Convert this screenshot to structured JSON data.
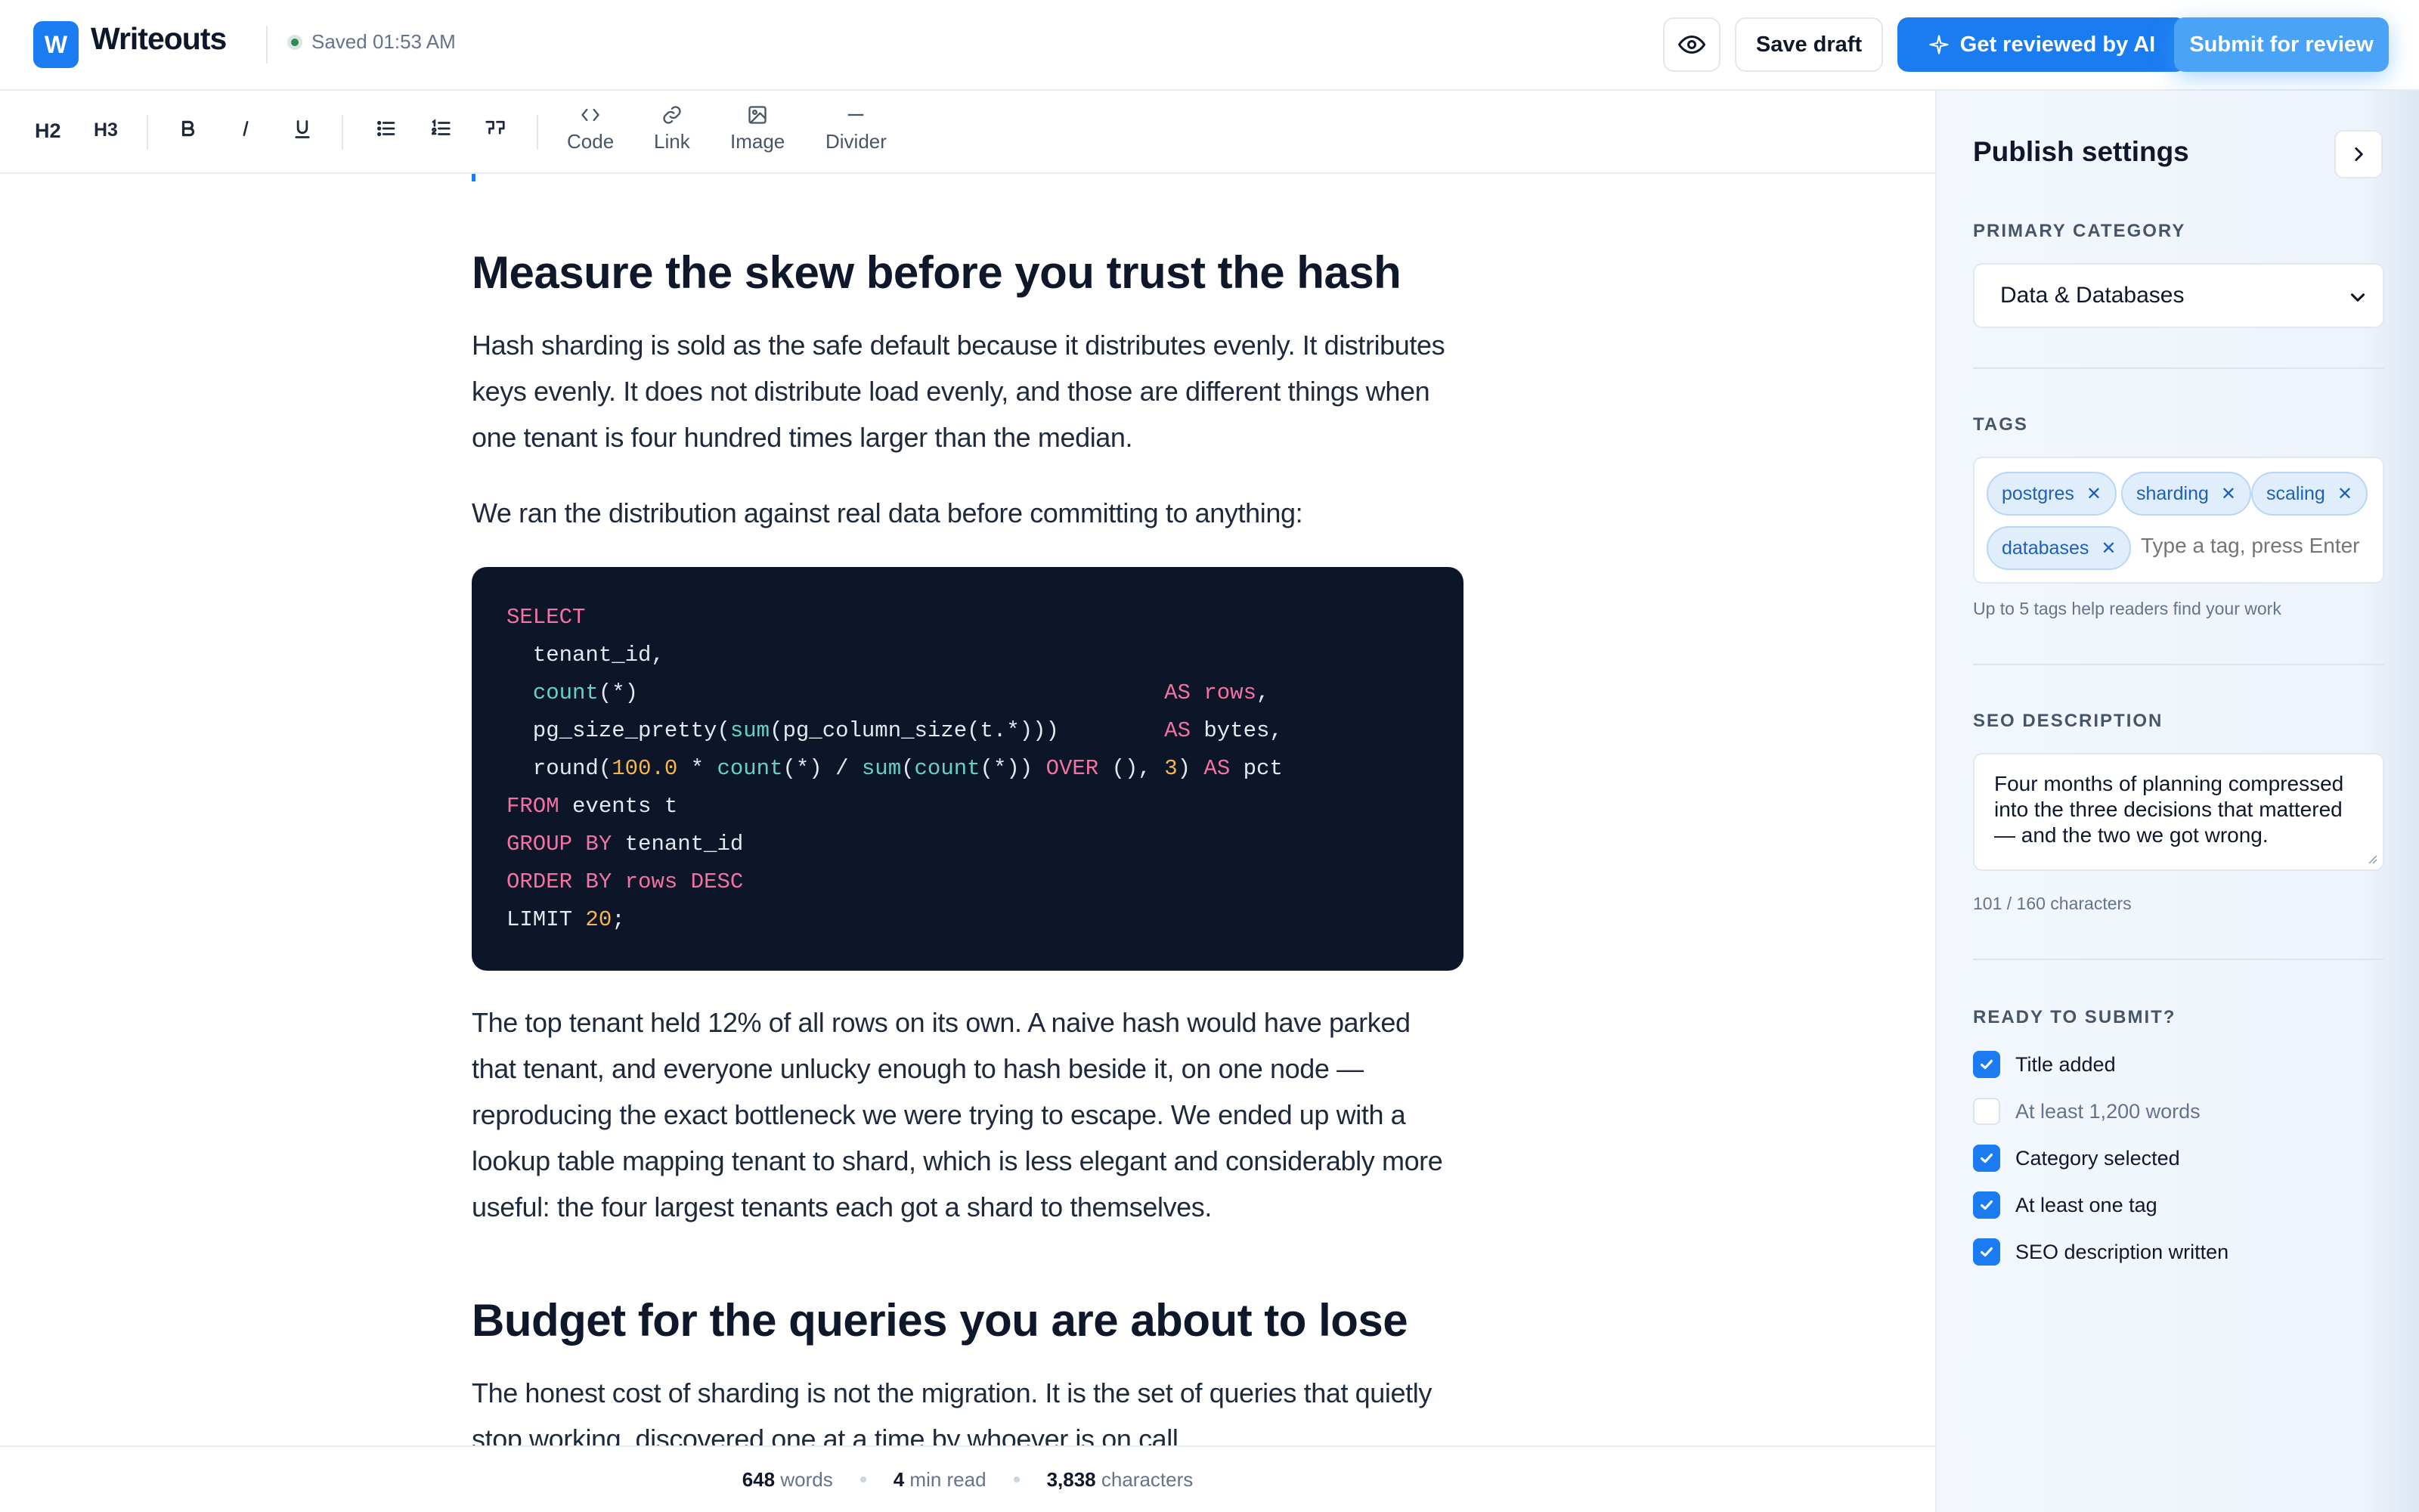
{
  "app": {
    "logo_letter": "W",
    "name": "Writeouts",
    "save_status": "Saved 01:53 AM"
  },
  "actions": {
    "save_draft": "Save draft",
    "ai_review": "Get reviewed by AI",
    "submit": "Submit for review"
  },
  "toolbar": {
    "h2": "H2",
    "h3": "H3",
    "code": "Code",
    "link": "Link",
    "image": "Image",
    "divider": "Divider"
  },
  "article": {
    "heading_1": "Measure the skew before you trust the hash",
    "para_1": "Hash sharding is sold as the safe default because it distributes evenly. It distributes keys evenly. It does not distribute load evenly, and those are different things when one tenant is four hundred times larger than the median.",
    "para_2": "We ran the distribution against real data before committing to anything:",
    "para_3": "The top tenant held 12% of all rows on its own. A naive hash would have parked that tenant, and everyone unlucky enough to hash beside it, on one node — reproducing the exact bottleneck we were trying to escape. We ended up with a lookup table mapping tenant to shard, which is less elegant and considerably more useful: the four largest tenants each got a shard to themselves.",
    "heading_2": "Budget for the queries you are about to lose",
    "para_4": "The honest cost of sharding is not the migration. It is the set of queries that quietly stop working, discovered one at a time by whoever is on call."
  },
  "stats": {
    "words": "648",
    "words_label": "words",
    "read": "4",
    "read_label": "min read",
    "chars": "3,838",
    "chars_label": "characters"
  },
  "panel": {
    "title": "Publish settings",
    "category_label": "PRIMARY CATEGORY",
    "category_value": "Data & Databases",
    "tags_label": "TAGS",
    "tags": [
      "postgres",
      "sharding",
      "scaling",
      "databases"
    ],
    "tag_placeholder": "Type a tag, press Enter",
    "tags_hint": "Up to 5 tags help readers find your work",
    "seo_label": "SEO DESCRIPTION",
    "seo_value": "Four months of planning compressed into the three decisions that mattered — and the two we got wrong.",
    "seo_count": "101 / 160 characters",
    "ready_label": "READY TO SUBMIT?",
    "checklist": [
      {
        "label": "Title added",
        "done": true
      },
      {
        "label": "At least 1,200 words",
        "done": false
      },
      {
        "label": "Category selected",
        "done": true
      },
      {
        "label": "At least one tag",
        "done": true
      },
      {
        "label": "SEO description written",
        "done": true
      }
    ]
  },
  "colors": {
    "accent": "#1a7cf0",
    "submit": "#4aa3f7",
    "code_bg": "#0c1628",
    "keyword": "#f472a2",
    "function": "#64d2c4",
    "number": "#f7b54d"
  }
}
